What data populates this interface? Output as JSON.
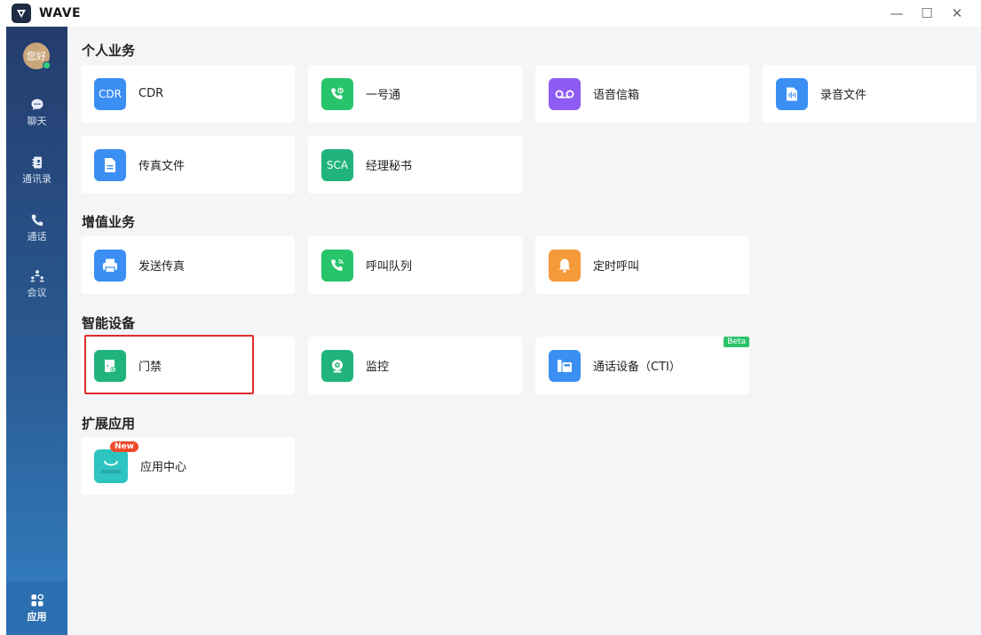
{
  "app": {
    "title": "WAVE"
  },
  "window_controls": {
    "minimize": "—",
    "maximize": "☐",
    "close": "✕"
  },
  "sidebar": {
    "avatar_text": "您好",
    "items": [
      {
        "label": "聊天",
        "icon": "chat-icon"
      },
      {
        "label": "通讯录",
        "icon": "contacts-icon"
      },
      {
        "label": "通话",
        "icon": "phone-icon"
      },
      {
        "label": "会议",
        "icon": "meeting-icon"
      },
      {
        "label": "应用",
        "icon": "apps-icon",
        "active": true
      }
    ]
  },
  "sections": [
    {
      "title": "个人业务",
      "cards": [
        {
          "label": "CDR",
          "icon_text": "CDR",
          "color": "#3b8ff3"
        },
        {
          "label": "一号通",
          "icon": "phone-forward-icon",
          "color": "#27c46b"
        },
        {
          "label": "语音信箱",
          "icon": "voicemail-icon",
          "color": "#8e5cf2"
        },
        {
          "label": "录音文件",
          "icon": "recording-icon",
          "color": "#3b8ff3"
        },
        {
          "label": "传真文件",
          "icon": "document-icon",
          "color": "#3b8ff3"
        },
        {
          "label": "经理秘书",
          "icon_text": "SCA",
          "color": "#20b47c"
        }
      ]
    },
    {
      "title": "增值业务",
      "cards": [
        {
          "label": "发送传真",
          "icon": "fax-icon",
          "color": "#3b8ff3"
        },
        {
          "label": "呼叫队列",
          "icon": "call-queue-icon",
          "color": "#27c46b"
        },
        {
          "label": "定时呼叫",
          "icon": "bell-icon",
          "color": "#f59a3a"
        }
      ]
    },
    {
      "title": "智能设备",
      "cards": [
        {
          "label": "门禁",
          "icon": "door-access-icon",
          "color": "#20b47c"
        },
        {
          "label": "监控",
          "icon": "camera-icon",
          "color": "#20b47c"
        },
        {
          "label": "通话设备（CTI）",
          "icon": "cti-device-icon",
          "color": "#3b8ff3",
          "badge": "Beta"
        }
      ]
    },
    {
      "title": "扩展应用",
      "cards": [
        {
          "label": "应用中心",
          "icon": "app-store-icon",
          "color": "#2ec4c0",
          "badge": "New"
        }
      ]
    }
  ]
}
